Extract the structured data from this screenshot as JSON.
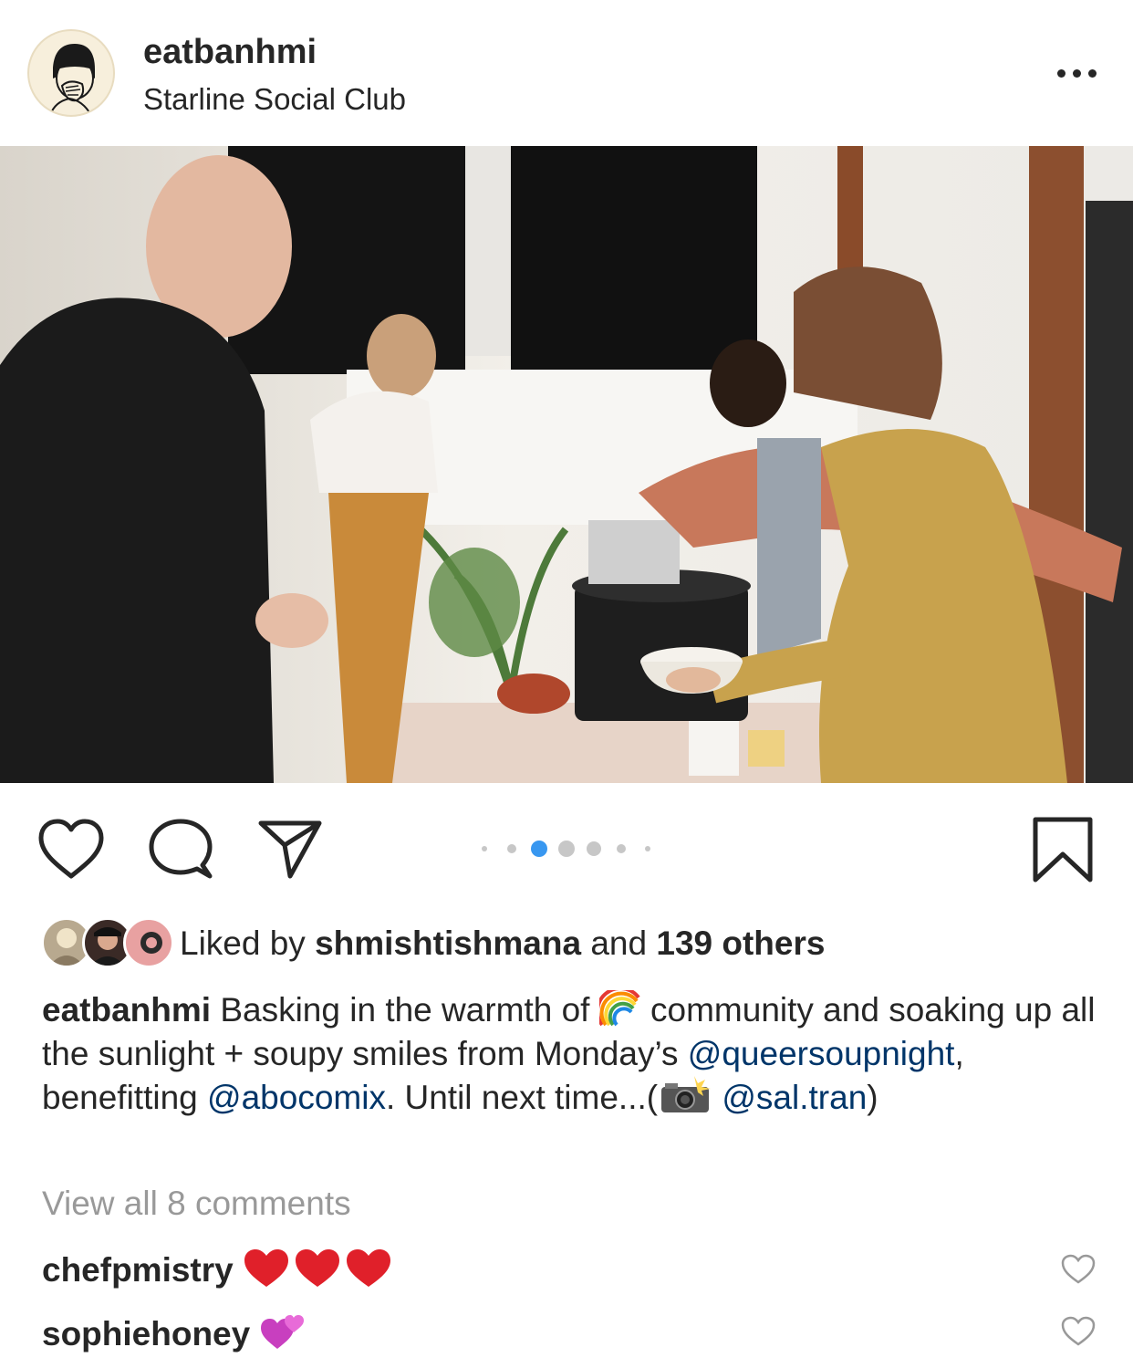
{
  "header": {
    "username": "eatbanhmi",
    "location": "Starline Social Club",
    "avatar_icon": "avatar-illustration-icon",
    "more_icon": "more-options-icon"
  },
  "photo": {
    "alt": "",
    "carousel": {
      "total": 7,
      "active_index": 2
    }
  },
  "actions": {
    "like_icon": "heart-icon",
    "comment_icon": "comment-icon",
    "share_icon": "direct-share-icon",
    "save_icon": "bookmark-icon",
    "accent_color": "#3897f0"
  },
  "likes": {
    "prefix": "Liked by ",
    "first_liker": "shmishtishmana",
    "and": " and ",
    "others": "139 others"
  },
  "caption": {
    "author": "eatbanhmi",
    "part1": " Basking in the warmth of ",
    "emoji1": "rainbow",
    "part2": " community and soaking up all the sunlight + soupy smiles from Monday’s ",
    "mention1": "@queersoupnight",
    "part3": ", benefitting ",
    "mention2": "@abocomix",
    "part4": ". Until next time...(",
    "emoji2": "camera-flash",
    "part5": " ",
    "mention3": "@sal.tran",
    "part6": ")"
  },
  "view_all_comments": "View all 8 comments",
  "comments": [
    {
      "user": "chefpmistry",
      "emoji": "❤️❤️❤️"
    },
    {
      "user": "sophiehoney",
      "emoji": "💞"
    }
  ]
}
